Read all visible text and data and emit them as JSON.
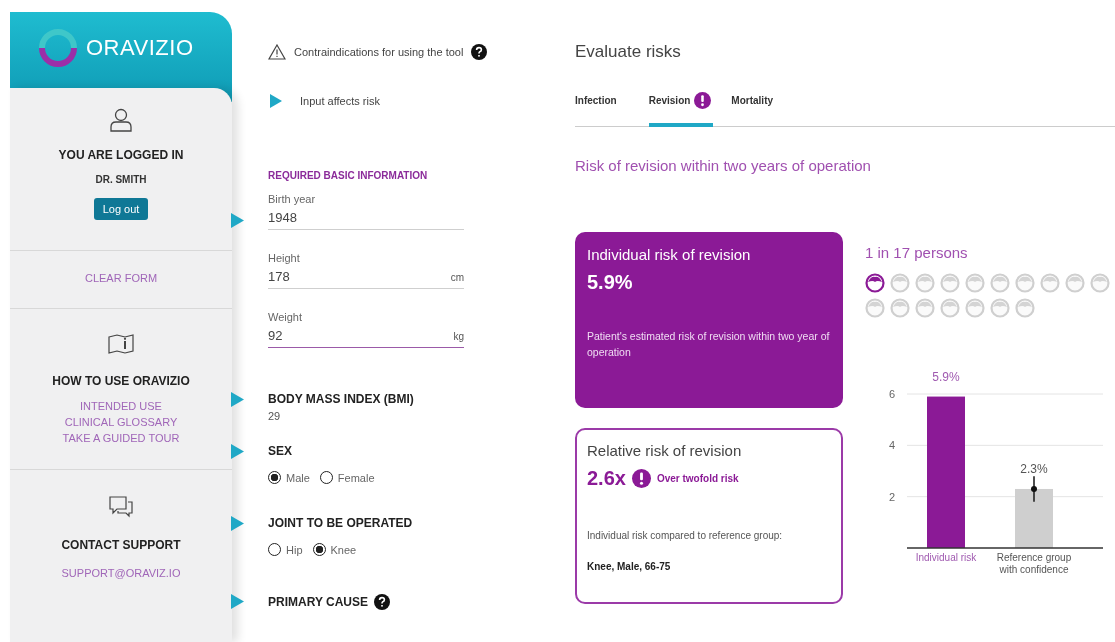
{
  "sidebar": {
    "brand": "ORAVIZIO",
    "user": {
      "heading": "YOU ARE LOGGED IN",
      "name": "DR. SMITH",
      "button": "Log out"
    },
    "clear_form": "CLEAR FORM",
    "help": {
      "heading": "HOW TO USE ORAVIZIO",
      "links": [
        "INTENDED USE",
        "CLINICAL GLOSSARY",
        "TAKE A GUIDED TOUR"
      ]
    },
    "contact": {
      "heading": "CONTACT SUPPORT",
      "email": "SUPPORT@ORAVIZ.IO"
    }
  },
  "form": {
    "contraindications": "Contraindications for using the tool",
    "legend": "Input affects risk",
    "section_title": "REQUIRED BASIC INFORMATION",
    "fields": [
      {
        "label": "Birth year",
        "value": "1948",
        "focused": false,
        "affects_risk": true
      },
      {
        "label": "Height",
        "value": "178",
        "unit": "cm",
        "focused": false,
        "affects_risk": false
      },
      {
        "label": "Weight",
        "value": "92",
        "unit": "kg",
        "focused": true,
        "affects_risk": false
      }
    ],
    "bmi": {
      "label": "BODY MASS INDEX (BMI)",
      "value": "29",
      "affects_risk": true
    },
    "groups": [
      {
        "label": "SEX",
        "affects_risk": true,
        "options": [
          {
            "label": "Male",
            "selected": true
          },
          {
            "label": "Female",
            "selected": false
          }
        ]
      },
      {
        "label": "JOINT TO BE OPERATED",
        "affects_risk": true,
        "options": [
          {
            "label": "Hip",
            "selected": false
          },
          {
            "label": "Knee",
            "selected": true
          }
        ]
      }
    ],
    "primary_cause": {
      "label": "PRIMARY CAUSE",
      "affects_risk": true
    }
  },
  "results": {
    "title": "Evaluate risks",
    "tabs": [
      {
        "label": "Infection",
        "selected": false,
        "alert": false
      },
      {
        "label": "Revision",
        "selected": true,
        "alert": true
      },
      {
        "label": "Mortality",
        "selected": false,
        "alert": false
      }
    ],
    "subtitle": "Risk of revision within two years of operation",
    "individual": {
      "title": "Individual risk of revision",
      "value": "5.9%",
      "description": "Patient's estimated risk of revision within two year of operation"
    },
    "persons": {
      "caption": "1 in 17 persons",
      "people": [
        {
          "highlighted": true
        },
        {
          "highlighted": false
        },
        {
          "highlighted": false
        },
        {
          "highlighted": false
        },
        {
          "highlighted": false
        },
        {
          "highlighted": false
        },
        {
          "highlighted": false
        },
        {
          "highlighted": false
        },
        {
          "highlighted": false
        },
        {
          "highlighted": false
        },
        {
          "highlighted": false
        },
        {
          "highlighted": false
        },
        {
          "highlighted": false
        },
        {
          "highlighted": false
        },
        {
          "highlighted": false
        },
        {
          "highlighted": false
        },
        {
          "highlighted": false
        }
      ]
    },
    "relative": {
      "title": "Relative risk of revision",
      "value": "2.6x",
      "note": "Over twofold risk",
      "comparison": "Individual risk compared to reference group:",
      "reference": "Knee, Male, 66-75"
    },
    "chart_data": {
      "type": "bar",
      "categories": [
        "Individual risk",
        "Reference group with confidence"
      ],
      "values": [
        5.9,
        2.3
      ],
      "ylim": [
        0,
        6
      ],
      "yticks": [
        2,
        4,
        6
      ],
      "value_labels": [
        "5.9%",
        "2.3%"
      ]
    }
  }
}
